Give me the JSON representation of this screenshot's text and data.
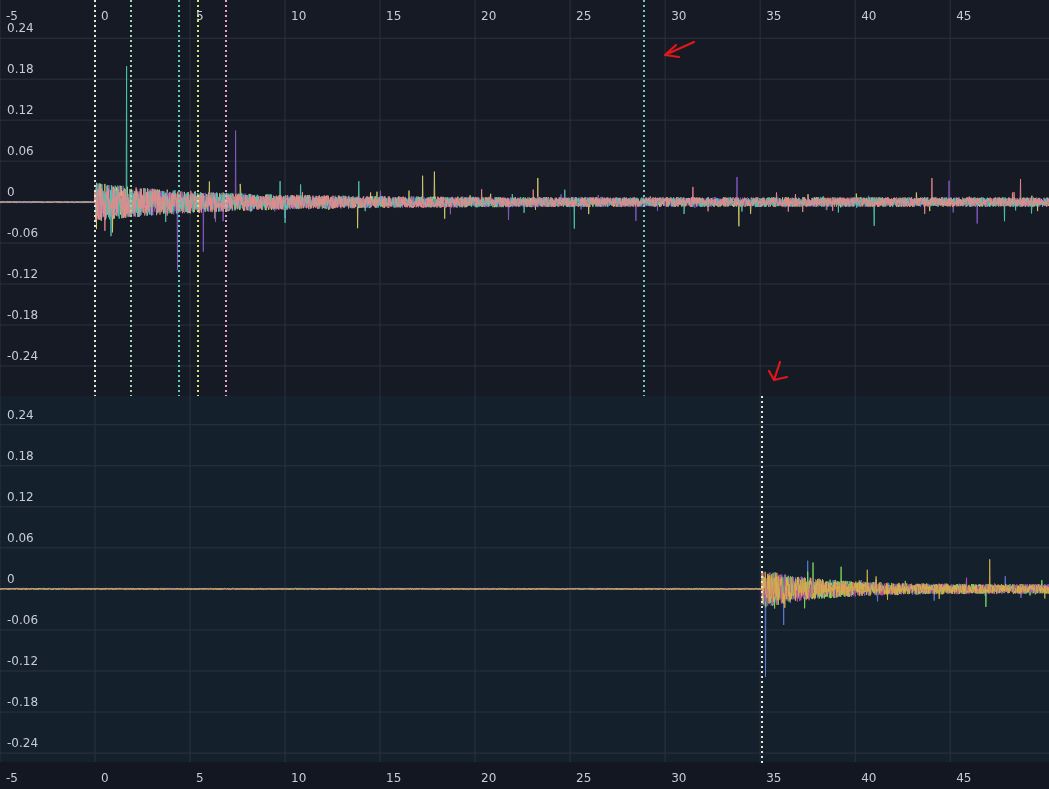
{
  "panels": [
    {
      "x_tick_labels": [
        "-5",
        "0",
        "5",
        "10",
        "15",
        "20",
        "25",
        "30",
        "35",
        "40",
        "45"
      ],
      "y_tick_labels": [
        "0.24",
        "0.18",
        "0.12",
        "0.06",
        "0",
        "-0.06",
        "-0.12",
        "-0.18",
        "-0.24"
      ],
      "markers": [
        {
          "color": "#e8e8d8"
        },
        {
          "color": "#9ad8a8"
        },
        {
          "color": "#5fd0c0"
        },
        {
          "color": "#e0e070"
        },
        {
          "color": "#f0a0d0"
        },
        {
          "color": "#70c8c0"
        }
      ]
    },
    {
      "x_tick_labels": [
        "-5",
        "0",
        "5",
        "10",
        "15",
        "20",
        "25",
        "30",
        "35",
        "40",
        "45"
      ],
      "y_tick_labels": [
        "0.24",
        "0.18",
        "0.12",
        "0.06",
        "0",
        "-0.06",
        "-0.12",
        "-0.18",
        "-0.24"
      ],
      "markers": [
        {
          "color": "#e8e8d8"
        }
      ]
    }
  ]
}
